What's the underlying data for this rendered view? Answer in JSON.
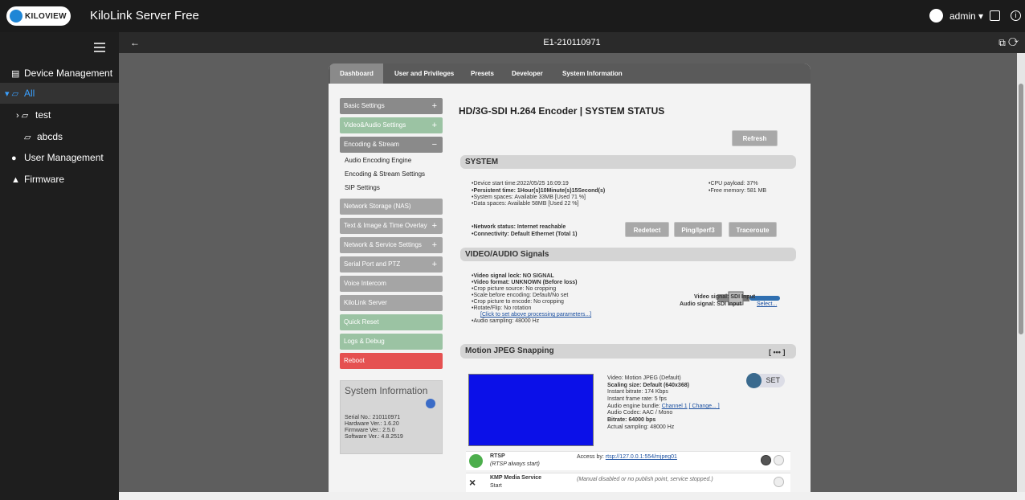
{
  "app": {
    "logo_text": "KILOVIEW",
    "name": "KiloLink Server Free",
    "user": "admin ▾",
    "back_glyph": "←",
    "tab_icons": "⧉ ⟳",
    "info_glyph": "i"
  },
  "sidebar": {
    "items": [
      {
        "label": "Device Management",
        "glyph": "▤",
        "chev": "^"
      },
      {
        "label": "All",
        "glyph": "▾ ▱"
      },
      {
        "label": "test",
        "glyph": "› ▱"
      },
      {
        "label": "abcds",
        "glyph": "▱"
      },
      {
        "label": "User Management",
        "glyph": "●"
      },
      {
        "label": "Firmware",
        "glyph": "▲"
      }
    ]
  },
  "device": {
    "title": "E1-210110971"
  },
  "nav_tabs": [
    "Dashboard",
    "User and Privileges",
    "Presets",
    "Developer",
    "System Information"
  ],
  "menu": {
    "items": [
      "Basic Settings",
      "Video&Audio Settings",
      "Encoding & Stream",
      "Network Storage (NAS)",
      "Text & Image & Time Overlay",
      "Network & Service Settings",
      "Serial Port and PTZ",
      "Voice Intercom",
      "KiloLink Server",
      "Quick Reset",
      "Logs & Debug",
      "Reboot"
    ],
    "sub": [
      "Audio Encoding Engine",
      "Encoding & Stream Settings",
      "SIP Settings"
    ],
    "plus": "+",
    "minus": "−"
  },
  "sysinfo": {
    "title": "System Information",
    "serial": "Serial No.: 210110971",
    "hardware": "Hardware Ver.: 1.6.20",
    "firmware": "Firmware Ver.: 2.5.0",
    "software": "Software Ver.: 4.8.2519"
  },
  "main": {
    "heading": "HD/3G-SDI H.264 Encoder | SYSTEM STATUS",
    "refresh": "Refresh",
    "system": {
      "title": "SYSTEM",
      "lines": [
        "Device start time:2022/05/25 16:09:19",
        "Persistent time: 1Hour(s)10Minute(s)15Second(s)",
        "System spaces: Available 33MB [Used 71 %]",
        "Data spaces: Available 58MB [Used 22 %]"
      ],
      "cpu": "CPU payload: 37%",
      "mem": "Free memory: 581 MB",
      "net": "Network status: Internet reachable",
      "conn": "Connectivity: Default Ethernet (Total 1)",
      "buttons": [
        "Redetect",
        "Ping/Iperf3",
        "Traceroute"
      ]
    },
    "signals": {
      "title": "VIDEO/AUDIO Signals",
      "lines": [
        "Video signal lock: NO SIGNAL",
        "Video format: UNKNOWN (Before loss)",
        "Crop picture source: No cropping",
        "Scale before encoding: Default/No set",
        "Crop picture to encode: No cropping",
        "Rotate/Flip: No rotation"
      ],
      "link": "[Click to set above processing parameters...]",
      "audio": "Audio sampling: 48000 Hz",
      "video_signal": "Video signal: SDI Input",
      "audio_signal": "Audio signal: SDI Input",
      "select": "Select..."
    },
    "mjpeg": {
      "title": "Motion JPEG Snapping",
      "dots": "[ ••• ]",
      "set": "SET",
      "video": "Video: Motion JPEG (Default)",
      "scaling": "Scaling size: Default (640x368)",
      "bitrate": "Instant bitrate: 174 Kbps",
      "framerate": "Instant frame rate: 5 fps",
      "engine_label": "Audio engine bundle: ",
      "channel": "Channel 1",
      "change": "[ Change... ]",
      "codec": "Audio Codec: AAC / Mono",
      "abitrate": "Bitrate: 64000 bps",
      "sampling": "Actual sampling: 48000 Hz"
    },
    "rtsp": {
      "name": "RTSP",
      "sub": "(RTSP always start)",
      "access": "Access by: ",
      "url": "rtsp://127.0.0.1:554/mjpeg01"
    },
    "kmp": {
      "name": "KMP Media Service",
      "sub": "Start",
      "note": "(Manual disabled or no publish point, service stopped.)"
    }
  }
}
